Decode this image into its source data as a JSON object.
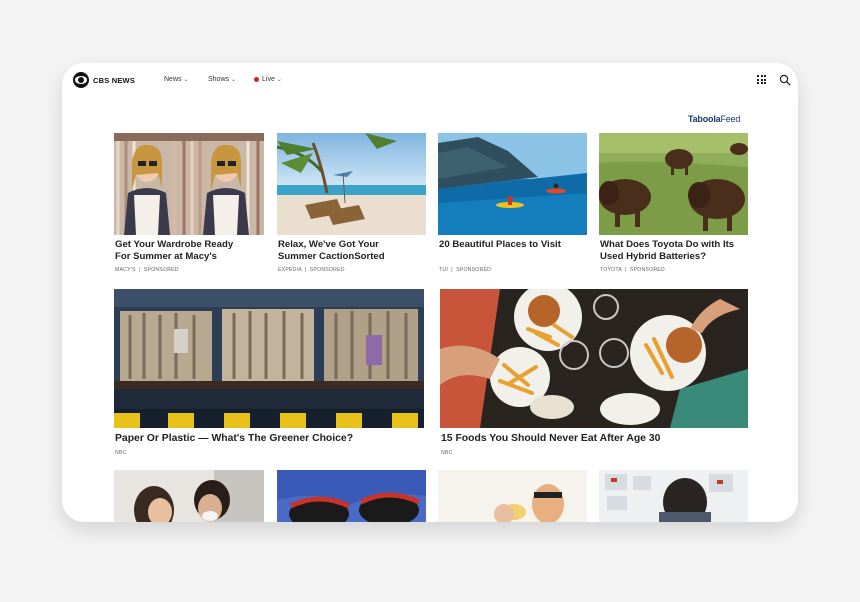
{
  "brand": {
    "name": "CBS NEWS"
  },
  "nav": {
    "news": "News",
    "shows": "Shows",
    "live": "Live"
  },
  "feed": {
    "brand": "Taboola",
    "suffix": "Feed"
  },
  "cards": [
    {
      "title_line1": "Get Your Wardrobe Ready",
      "title_line2": "For Summer at Macy's",
      "source": "MACY'S",
      "sponsored": "SPONSORED"
    },
    {
      "title_line1": "Relax, We've Got Your",
      "title_line2": "Summer CactionSorted",
      "source": "EXPEDIA",
      "sponsored": "SPONSORED"
    },
    {
      "title_line1": "20 Beautiful Places to Visit",
      "title_line2": "",
      "source": "TUI",
      "sponsored": "SPONSORED"
    },
    {
      "title_line1": "What Does Toyota Do with Its",
      "title_line2": "Used Hybrid Batteries?",
      "source": "TOYOTA",
      "sponsored": "SPONSORED"
    }
  ],
  "wide_cards": [
    {
      "title": "Paper Or Plastic — What's The Greener Choice?",
      "source": "NBC"
    },
    {
      "title": "15 Foods You Should Never Eat After Age 30",
      "source": "NBC"
    }
  ],
  "separator": "|",
  "colors": {
    "live_dot": "#d3202f",
    "taboola": "#1b3c6e"
  }
}
